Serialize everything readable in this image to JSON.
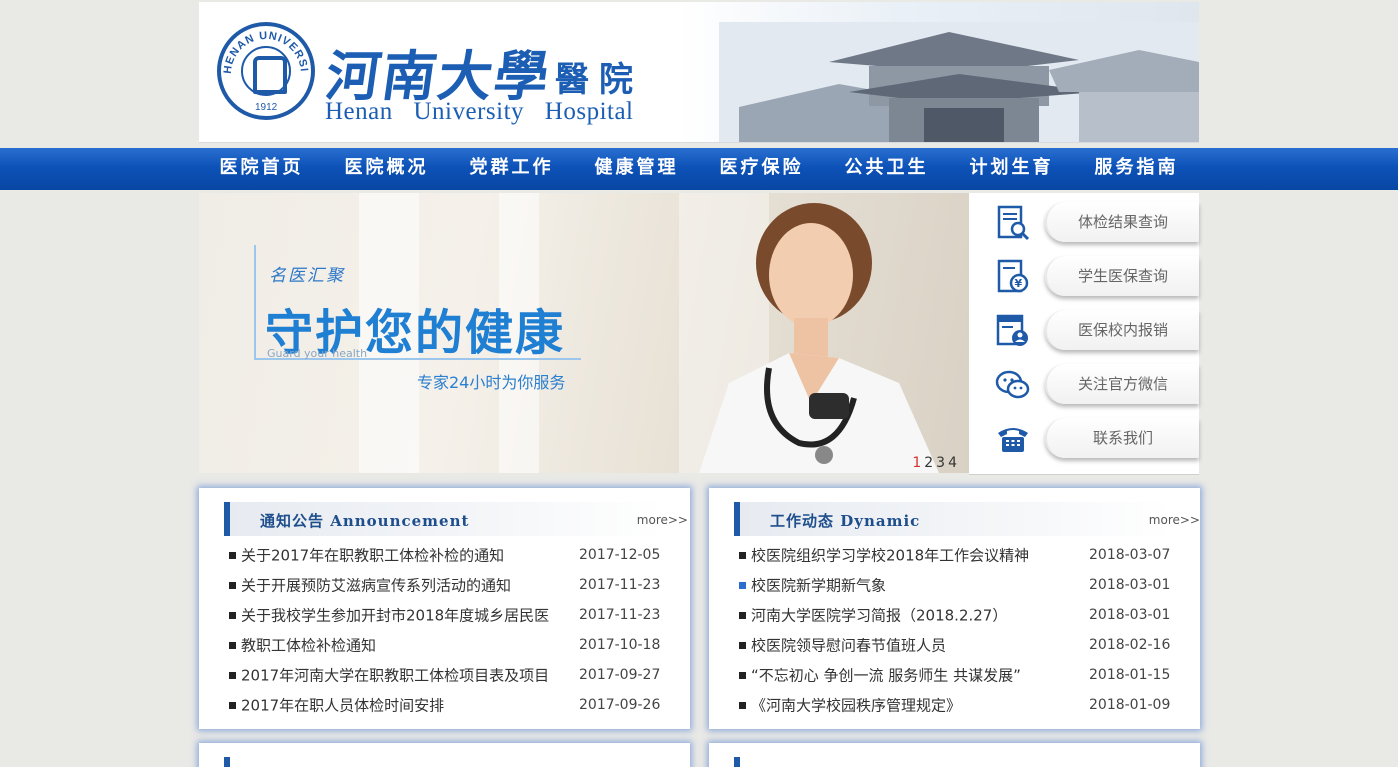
{
  "header": {
    "seal_text": "HENAN UNIVERSITY 1912",
    "logo_cn": "河南大學",
    "logo_cn2": "醫院",
    "logo_en": "Henan University Hospital"
  },
  "nav": {
    "items": [
      {
        "label": "医院首页"
      },
      {
        "label": "医院概况"
      },
      {
        "label": "党群工作"
      },
      {
        "label": "健康管理"
      },
      {
        "label": "医疗保险"
      },
      {
        "label": "公共卫生"
      },
      {
        "label": "计划生育"
      },
      {
        "label": "服务指南"
      }
    ]
  },
  "banner": {
    "calligraphy": "名医汇聚",
    "title": "守护您的健康",
    "subtitle": "Guard your health",
    "slogan": "专家24小时为你服务",
    "pages": [
      "1",
      "2",
      "3",
      "4"
    ],
    "active_page": "1"
  },
  "quick_links": [
    {
      "label": "体检结果查询",
      "icon": "report-search-icon"
    },
    {
      "label": "学生医保查询",
      "icon": "yuan-document-icon"
    },
    {
      "label": "医保校内报销",
      "icon": "id-card-icon"
    },
    {
      "label": "关注官方微信",
      "icon": "wechat-icon"
    },
    {
      "label": "联系我们",
      "icon": "telephone-icon"
    }
  ],
  "announcements": {
    "title": "通知公告 Announcement",
    "more": "more>>",
    "items": [
      {
        "title": "关于2017年在职教职工体检补检的通知",
        "date": "2017-12-05"
      },
      {
        "title": "关于开展预防艾滋病宣传系列活动的通知",
        "date": "2017-11-23"
      },
      {
        "title": "关于我校学生参加开封市2018年度城乡居民医",
        "date": "2017-11-23"
      },
      {
        "title": "教职工体检补检通知",
        "date": "2017-10-18"
      },
      {
        "title": "2017年河南大学在职教职工体检项目表及项目",
        "date": "2017-09-27"
      },
      {
        "title": "2017年在职人员体检时间安排",
        "date": "2017-09-26"
      }
    ]
  },
  "dynamics": {
    "title": "工作动态 Dynamic",
    "more": "more>>",
    "items": [
      {
        "title": "校医院组织学习学校2018年工作会议精神",
        "date": "2018-03-07"
      },
      {
        "title": "校医院新学期新气象",
        "date": "2018-03-01"
      },
      {
        "title": "河南大学医院学习简报（2018.2.27）",
        "date": "2018-03-01"
      },
      {
        "title": "校医院领导慰问春节值班人员",
        "date": "2018-02-16"
      },
      {
        "title": "“不忘初心 争创一流 服务师生 共谋发展”",
        "date": "2018-01-15"
      },
      {
        "title": "《河南大学校园秩序管理规定》",
        "date": "2018-01-09"
      }
    ]
  },
  "colors": {
    "brand_blue": "#1b5eb3",
    "nav_blue": "#0d52b8",
    "page_bg": "#e9e9e6"
  }
}
